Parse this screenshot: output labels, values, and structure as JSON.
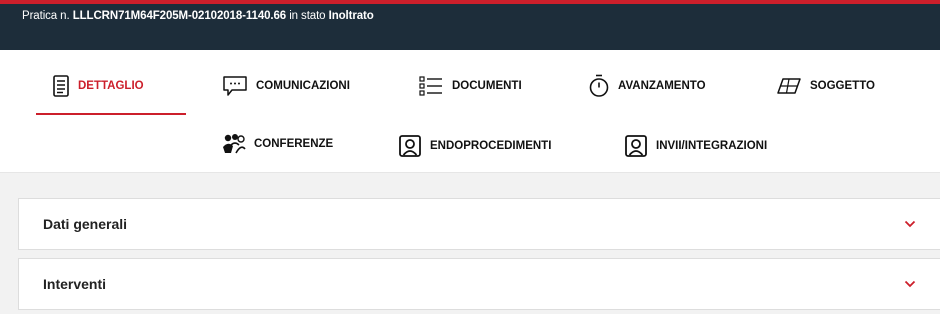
{
  "header": {
    "prefix": "Pratica n.",
    "number": "LLLCRN71M64F205M-02102018-1140.66",
    "status_prefix": "in stato",
    "status": "Inoltrato"
  },
  "tabs_row1": [
    {
      "label": "DETTAGLIO",
      "icon": "document-list-icon",
      "active": true
    },
    {
      "label": "COMUNICAZIONI",
      "icon": "chat-bubble-icon"
    },
    {
      "label": "DOCUMENTI",
      "icon": "list-icon"
    },
    {
      "label": "AVANZAMENTO",
      "icon": "stopwatch-icon"
    },
    {
      "label": "SOGGETTO",
      "icon": "parallelogram-icon"
    }
  ],
  "tabs_row2": [
    {
      "label": "CONFERENZE",
      "icon": "people-group-icon"
    },
    {
      "label": "ENDOPROCEDIMENTI",
      "icon": "contact-card-icon"
    },
    {
      "label": "INVII/INTEGRAZIONI",
      "icon": "contact-card-icon"
    }
  ],
  "panels": [
    {
      "title": "Dati generali"
    },
    {
      "title": "Interventi"
    }
  ],
  "colors": {
    "accent": "#cc1f2b",
    "topbar": "#1d2d3a",
    "background": "#f2f2f2"
  }
}
